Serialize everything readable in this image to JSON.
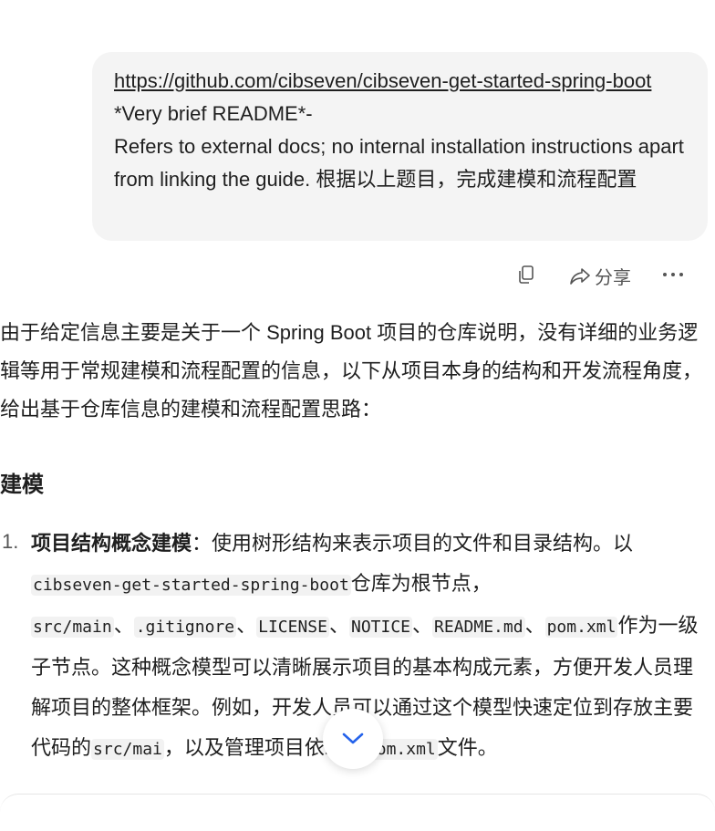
{
  "user_message": {
    "link": "https://github.com/cibseven/cibseven-get-started-spring-boot",
    "line2": " *Very brief README*-",
    "line3": "Refers to external docs; no internal installation instructions apart from linking the guide.   根据以上题目，完成建模和流程配置"
  },
  "actions": {
    "share_label": "分享"
  },
  "answer": {
    "intro": "由于给定信息主要是关于一个 Spring Boot 项目的仓库说明，没有详细的业务逻辑等用于常规建模和流程配置的信息，以下从项目本身的结构和开发流程角度，给出基于仓库信息的建模和流程配置思路：",
    "heading": "建模",
    "item1": {
      "number": "1.",
      "title": "项目结构概念建模",
      "t1": "：使用树形结构来表示项目的文件和目录结构。以",
      "c_repo": "cibseven-get-started-spring-boot",
      "t2": "仓库为根节点，",
      "c_src": "src/main",
      "sep": "、",
      "c_gitignore": ".gitignore",
      "c_license": "LICENSE",
      "c_notice": "NOTICE",
      "c_readme": "README.md",
      "c_pom": "pom.xml",
      "t3": "作为一级子节点。这种概念模型可以清晰展示项目的基本构成元素，方便开发人员理解项目的整体框架。例如，开发人员可以通过这个模型快速定位到存放主要代码的",
      "c_src2": "src/mai",
      "t4": "，以及管理项目依赖的",
      "c_pom2": "pom.xml",
      "t5": "文件。"
    }
  },
  "colors": {
    "bubble_bg": "#f4f4f4",
    "text": "#1f1f1f",
    "icon": "#555555"
  }
}
